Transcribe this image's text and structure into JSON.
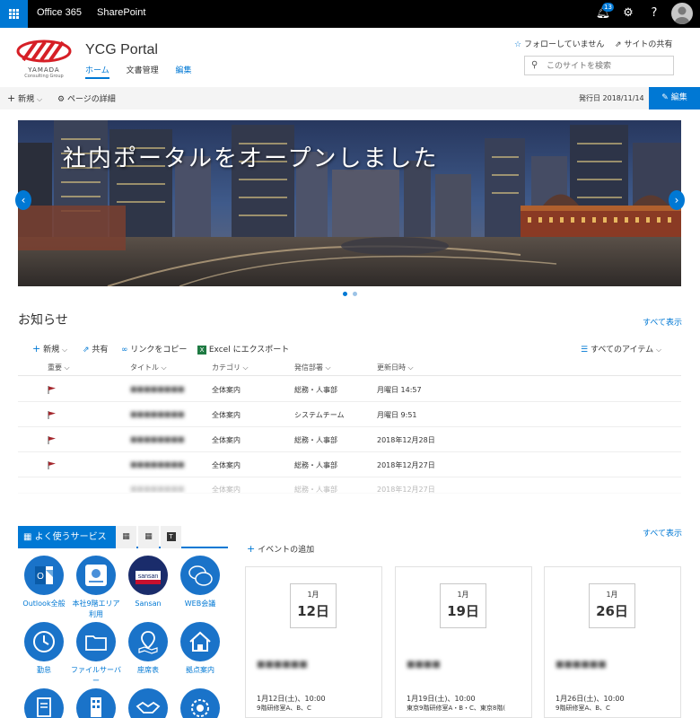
{
  "suitebar": {
    "app1": "Office 365",
    "app2": "SharePoint",
    "notifications_count": "13"
  },
  "site": {
    "logo_text": "YAMADA",
    "logo_sub": "Consulting Group",
    "title": "YCG Portal",
    "nav": [
      "ホーム",
      "文書管理",
      "編集"
    ],
    "follow_label": "フォローしていません",
    "share_label": "サイトの共有",
    "search_placeholder": "このサイトを検索"
  },
  "command_bar": {
    "new_label": "新規",
    "page_details_label": "ページの詳細",
    "published": "発行日 2018/11/14",
    "edit_label": "編集"
  },
  "hero": {
    "title": "社内ポータルをオープンしました"
  },
  "news": {
    "title": "お知らせ",
    "see_all": "すべて表示",
    "commands": {
      "new": "新規",
      "share": "共有",
      "copy_link": "リンクをコピー",
      "export": "Excel にエクスポート",
      "view": "すべてのアイテム"
    },
    "columns": [
      "重要",
      "タイトル",
      "カテゴリ",
      "発信部署",
      "更新日時"
    ],
    "rows": [
      {
        "title": "■■■■■■■■",
        "category": "全体案内",
        "dept": "総務・人事部",
        "date": "月曜日 14:57"
      },
      {
        "title": "■■■■■■■■",
        "category": "全体案内",
        "dept": "システムチーム",
        "date": "月曜日 9:51"
      },
      {
        "title": "■■■■■■■■",
        "category": "全体案内",
        "dept": "総務・人事部",
        "date": "2018年12月28日"
      },
      {
        "title": "■■■■■■■■",
        "category": "全体案内",
        "dept": "総務・人事部",
        "date": "2018年12月27日"
      },
      {
        "title": "■■■■■■■■",
        "category": "全体案内",
        "dept": "総務・人事部",
        "date": "2018年12月27日"
      }
    ]
  },
  "services": {
    "tab_active": "よく使うサービス",
    "items": [
      {
        "label": "Outlook全般"
      },
      {
        "label": "本社9階エリア利用"
      },
      {
        "label": "Sansan"
      },
      {
        "label": "WEB会議"
      },
      {
        "label": "勤怠"
      },
      {
        "label": "ファイルサーバー"
      },
      {
        "label": "座席表"
      },
      {
        "label": "拠点案内"
      }
    ]
  },
  "events": {
    "see_all": "すべて表示",
    "add_label": "イベントの追加",
    "items": [
      {
        "month": "1月",
        "day": "12日",
        "name": "■■■■■■",
        "time": "1月12日(土)、10:00",
        "location": "9階研修室A、B、C"
      },
      {
        "month": "1月",
        "day": "19日",
        "name": "■■■■",
        "time": "1月19日(土)、10:00",
        "location": "東京9階研修室A・B・C、東京8階("
      },
      {
        "month": "1月",
        "day": "26日",
        "name": "■■■■■■",
        "time": "1月26日(土)、10:00",
        "location": "9階研修室A、B、C"
      }
    ]
  },
  "colors": {
    "accent": "#0078d4",
    "suitebar": "#000000",
    "flag": "#a4262c"
  }
}
